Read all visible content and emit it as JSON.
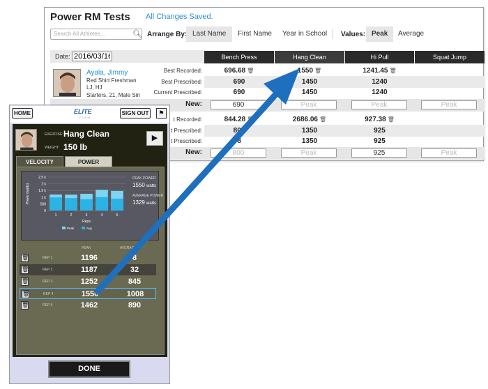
{
  "web": {
    "title": "Power RM Tests",
    "status": "All Changes Saved.",
    "search_placeholder": "Search All Athletes...",
    "arrange_by_label": "Arrange By:",
    "sort_options": [
      "Last Name",
      "First Name",
      "Year in School"
    ],
    "sort_active": "Last Name",
    "values_label": "Values:",
    "value_options": [
      "Peak",
      "Average"
    ],
    "value_active": "Peak",
    "date_label": "Date:",
    "date_value": "2016/03/16",
    "columns": [
      "Bench Press",
      "Hang Clean",
      "Hi Pull",
      "Squat Jump"
    ],
    "athlete": {
      "name": "Ayala, Jimmy",
      "line1": "Red Shirt Freshman",
      "line2": "LJ, HJ",
      "line3": "Starters, 21, Male Siri"
    },
    "row_labels": [
      "Best Recorded:",
      "Best Prescribed:",
      "Current Prescribed:",
      "New:"
    ],
    "row_labels_partial": [
      "t Recorded:",
      "t Prescribed:",
      "t Prescribed:",
      "New:"
    ],
    "block1": {
      "best_recorded": [
        "696.68",
        "1550",
        "1241.45",
        ""
      ],
      "best_prescribed": [
        "690",
        "1450",
        "1240",
        ""
      ],
      "current_prescribed": [
        "690",
        "1450",
        "1240",
        ""
      ],
      "new": [
        "690",
        "Peak",
        "Peak",
        "Peak"
      ]
    },
    "block2": {
      "best_recorded": [
        "844.28",
        "2686.06",
        "927.38",
        ""
      ],
      "best_prescribed": [
        "800",
        "1350",
        "925",
        ""
      ],
      "current_prescribed": [
        "8",
        "1350",
        "925",
        ""
      ],
      "new": [
        "800",
        "Peak",
        "925",
        "Peak"
      ]
    }
  },
  "mobile": {
    "home_label": "HOME",
    "signout_label": "SIGN OUT",
    "logo": "ELITE",
    "logo_sub": "FORM",
    "exercise_label": "EXERCISE:",
    "exercise": "Hang Clean",
    "weight_label": "WEIGHT:",
    "weight": "150 lb",
    "tabs": [
      "VELOCITY",
      "POWER"
    ],
    "active_tab": "POWER",
    "peak_power_label": "PEAK POWER",
    "peak_power": "1550",
    "peak_power_unit": "watts",
    "avg_power_label": "AVERAGE POWER",
    "avg_power": "1329",
    "avg_power_unit": "watts",
    "col_peak": "PEAK",
    "col_average": "AVERAGE",
    "reps": [
      {
        "label": "REP 1",
        "peak": "1196",
        "avg": "8"
      },
      {
        "label": "REP 2",
        "peak": "1187",
        "avg": "32"
      },
      {
        "label": "REP 3",
        "peak": "1252",
        "avg": "845"
      },
      {
        "label": "REP 4",
        "peak": "1550",
        "avg": "1008"
      },
      {
        "label": "REP 5",
        "peak": "1462",
        "avg": "890"
      }
    ],
    "done_label": "DONE"
  },
  "chart_data": {
    "type": "bar",
    "categories": [
      "1",
      "2",
      "3",
      "4",
      "5"
    ],
    "series": [
      {
        "name": "Peak",
        "values": [
          1196,
          1187,
          1252,
          1550,
          1462
        ]
      },
      {
        "name": "Avg",
        "values": [
          980,
          932,
          845,
          1008,
          890
        ]
      }
    ],
    "ylabel": "Power (watts)",
    "xlabel": "Reps",
    "yticks": [
      "2.5 k",
      "2 k",
      "1.5 k",
      "1 k",
      "500",
      "0"
    ],
    "ylim": [
      0,
      2500
    ],
    "legend": [
      "Peak",
      "Avg"
    ]
  },
  "colors": {
    "accent": "#2b8ed6",
    "arrow": "#1f6fbf",
    "peak_bar": "#7fd4f2",
    "avg_bar": "#2bb3e6"
  }
}
